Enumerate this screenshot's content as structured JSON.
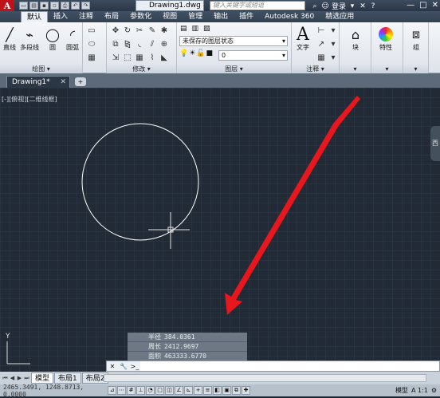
{
  "titlebar": {
    "logo": "A",
    "doc_title": "Drawing1.dwg",
    "search_placeholder": "键入关键字或短语",
    "login_label": "登录",
    "win_min": "—",
    "win_max": "□",
    "win_close": "✕"
  },
  "tabs": [
    "默认",
    "插入",
    "注释",
    "布局",
    "参数化",
    "视图",
    "管理",
    "输出",
    "插件",
    "Autodesk 360",
    "精选应用"
  ],
  "ribbon": {
    "draw": {
      "title": "绘图 ▾",
      "line": "直线",
      "polyline": "多段线",
      "circle": "圆",
      "arc": "圆弧"
    },
    "modify": {
      "title": "修改 ▾"
    },
    "layers": {
      "title": "图层 ▾",
      "layer_state": "未保存的图层状态",
      "current_layer": "0"
    },
    "annotation": {
      "title": "注释 ▾",
      "text": "文字"
    },
    "block": {
      "label": "块"
    },
    "properties": {
      "label": "特性"
    },
    "groups": {
      "label": "组"
    }
  },
  "file_tabs": {
    "active": "Drawing1*",
    "close": "✕",
    "add": "+"
  },
  "canvas": {
    "view_label": "[-][俯视][二维线框]",
    "nav_label": "西",
    "ucs_y": "Y",
    "circle_color": "#ffffff",
    "arrow_color": "#e8161d",
    "readout": [
      {
        "label": "半径",
        "value": "384.0361"
      },
      {
        "label": "周长",
        "value": "2412.9697"
      },
      {
        "label": "面积",
        "value": "463333.6770"
      }
    ]
  },
  "command": {
    "placeholder": "",
    "prompt_icon": ">_"
  },
  "layout_tabs": [
    "模型",
    "布局1",
    "布局2"
  ],
  "status": {
    "coords": "2465.3491, 1248.8713, 0.0000",
    "model_label": "模型",
    "scale_label": "A 1:1"
  }
}
